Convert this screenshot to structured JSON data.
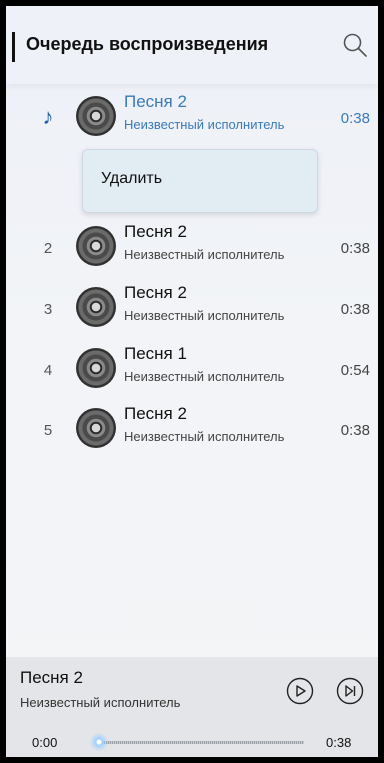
{
  "header": {
    "title": "Очередь воспроизведения",
    "search_icon": "search-icon"
  },
  "queue": [
    {
      "index": "",
      "title": "Песня 2",
      "artist": "Неизвестный исполнитель",
      "duration": "0:38",
      "playing": true
    },
    {
      "index": "2",
      "title": "Песня 2",
      "artist": "Неизвестный исполнитель",
      "duration": "0:38",
      "playing": false
    },
    {
      "index": "3",
      "title": "Песня 2",
      "artist": "Неизвестный исполнитель",
      "duration": "0:38",
      "playing": false
    },
    {
      "index": "4",
      "title": "Песня 1",
      "artist": "Неизвестный исполнитель",
      "duration": "0:54",
      "playing": false
    },
    {
      "index": "5",
      "title": "Песня 2",
      "artist": "Неизвестный исполнитель",
      "duration": "0:38",
      "playing": false
    }
  ],
  "playing_indicator": "♪",
  "context_menu": {
    "delete_label": "Удалить"
  },
  "player": {
    "title": "Песня 2",
    "artist": "Неизвестный исполнитель",
    "current_time": "0:00",
    "total_time": "0:38",
    "progress": 0.0
  },
  "colors": {
    "accent": "#3a7ab8",
    "playing_note": "#1f5fa8"
  }
}
